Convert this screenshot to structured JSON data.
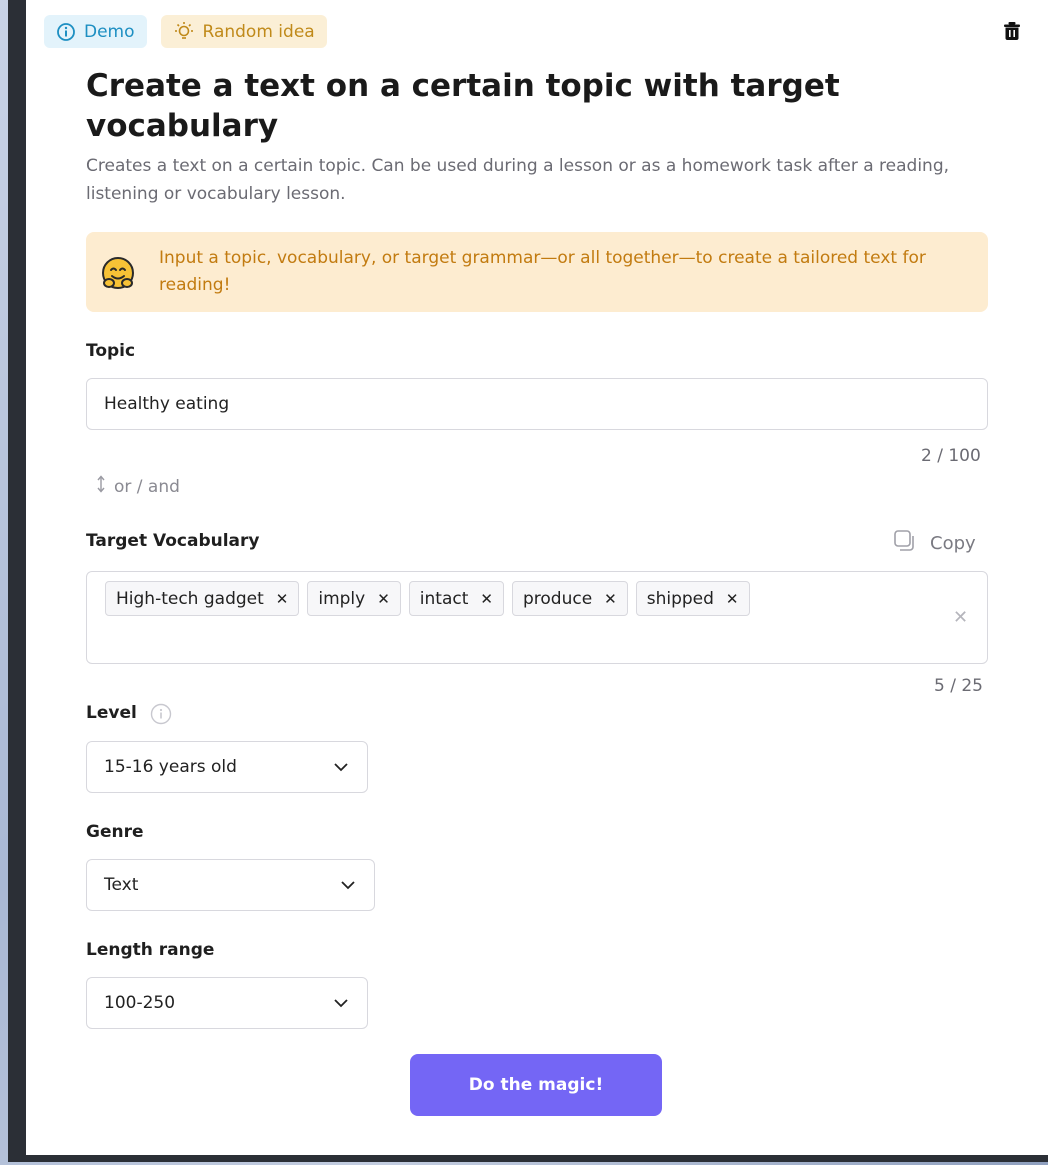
{
  "toolbar": {
    "demo_label": "Demo",
    "random_label": "Random idea"
  },
  "header": {
    "title": "Create a text on a certain topic with target vocabulary",
    "subtitle": "Creates a text on a certain topic. Can be used during a lesson or as a homework task after a reading, listening or vocabulary lesson."
  },
  "callout": {
    "text": "Input a topic, vocabulary, or target grammar—or all together—to create a tailored text for reading!"
  },
  "topic": {
    "label": "Topic",
    "value": "Healthy eating",
    "counter": "2 / 100"
  },
  "separator": "or / and",
  "vocabulary": {
    "label": "Target Vocabulary",
    "copy_label": "Copy",
    "tags": [
      "High-tech gadget",
      "imply",
      "intact",
      "produce",
      "shipped"
    ],
    "counter": "5 / 25"
  },
  "level": {
    "label": "Level",
    "value": "15-16 years old"
  },
  "genre": {
    "label": "Genre",
    "value": "Text"
  },
  "length": {
    "label": "Length range",
    "value": "100-250"
  },
  "submit_label": "Do the magic!",
  "colors": {
    "accent": "#7466f5",
    "demo_chip": "#e3f3fb",
    "random_chip": "#fbefd6",
    "callout_bg": "#fdecd0",
    "callout_text": "#c27b10"
  }
}
